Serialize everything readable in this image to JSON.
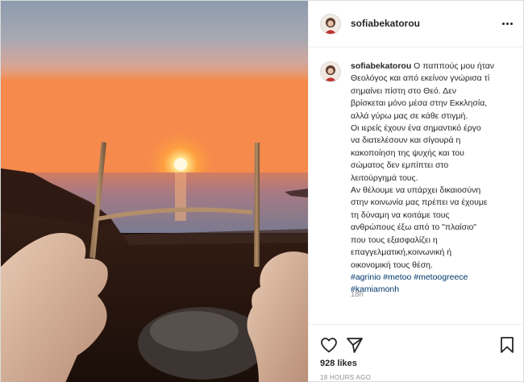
{
  "post": {
    "username": "sofiabekatorou",
    "caption_lines": [
      " Ο παππούς μου ήταν",
      "Θεολόγος και από εκείνον γνώρισα τί",
      "σημαίνει πίστη στο Θεό. Δεν",
      "βρίσκεται μόνο μέσα στην Εκκλησία,",
      "αλλά γύρω μας σε κάθε στιγμή.",
      "Οι ιερείς έχουν ένα σημαντικό έργο",
      "να διατελέσουν και σίγουρά η",
      "κακοποίηση της ψυχής και του",
      "σώματος δεν εμπίπτει στο",
      "λειτούργημά τους.",
      "Αν θέλουμε να υπάρχει δικαιοσύνη",
      "στην κοινωνία μας πρέπει να έχουμε",
      "τη δύναμη να κοιτάμε τους",
      "ανθρώπους έξω από το \"πλαίσιο\"",
      "που τους εξασφαλίζει η",
      "επαγγελματική,κοινωνική ή",
      "οικονομική τους θέση."
    ],
    "hashtags_line1": [
      "#agrinio",
      "#metoo",
      "#metoogreece"
    ],
    "hashtags_line2": [
      "#kamiamonh"
    ],
    "time_ago": "18h",
    "likes": "928 likes",
    "date": "18 HOURS AGO"
  },
  "icons": {
    "more": "more-options-icon",
    "like": "heart-icon",
    "share": "share-paper-plane-icon",
    "save": "bookmark-icon"
  },
  "colors": {
    "hashtag": "#00376b",
    "muted": "#8e8e8e",
    "text": "#262626",
    "border": "#efefef"
  }
}
